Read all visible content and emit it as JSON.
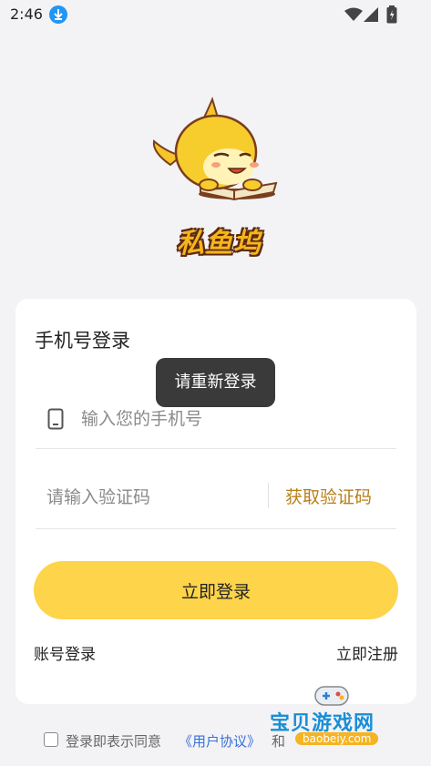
{
  "status_bar": {
    "time": "2:46",
    "icons": [
      "download-icon",
      "wifi-icon",
      "signal-icon",
      "battery-icon"
    ]
  },
  "app": {
    "name": "私鱼坞",
    "logo_icon": "shark-reading-book-icon"
  },
  "login": {
    "title": "手机号登录",
    "phone_placeholder": "输入您的手机号",
    "code_placeholder": "请输入验证码",
    "get_code_label": "获取验证码",
    "submit_label": "立即登录",
    "account_login_label": "账号登录",
    "register_label": "立即注册"
  },
  "toast": {
    "message": "请重新登录"
  },
  "agreement": {
    "prefix": "登录即表示同意",
    "user_agreement_link": "《用户协议》",
    "and": "和"
  },
  "watermark": {
    "title": "宝贝游戏网",
    "subtitle": "baobeiy.com",
    "icon": "gamepad-icon"
  },
  "colors": {
    "background": "#f3f3f5",
    "accent": "#fdd44a",
    "get_code": "#b8801a",
    "link": "#3a6fd8",
    "toast_bg": "#3a3a3a"
  }
}
